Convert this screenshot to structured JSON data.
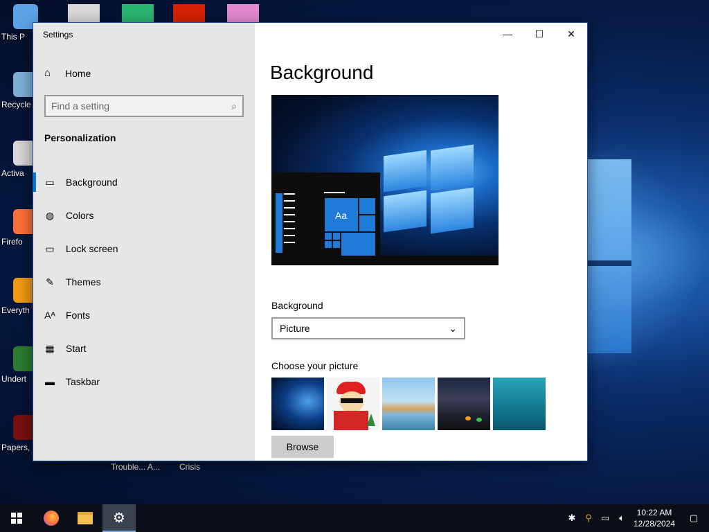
{
  "desktop": {
    "icons": [
      {
        "label": "This P",
        "color": "#5da4e6"
      },
      {
        "label": "Recycle",
        "color": "#7fb2d8"
      },
      {
        "label": "Activa",
        "color": "#d9d9d9"
      },
      {
        "label": "Firefo",
        "color": "#ff7139"
      },
      {
        "label": "Everyth",
        "color": "#f39c12"
      },
      {
        "label": "Undert",
        "color": "#2e7d32"
      },
      {
        "label": "Papers, P",
        "color": "#7a1010"
      }
    ],
    "top_icons": [
      {
        "color": "#d9d9d9"
      },
      {
        "color": "#2bb673"
      },
      {
        "color": "#d62300"
      },
      {
        "color": "#e38ad0"
      }
    ],
    "behind_labels": [
      "Trouble... A...",
      "Crisis"
    ]
  },
  "window": {
    "title": "Settings",
    "controls": {
      "minimize": "—",
      "maximize": "☐",
      "close": "✕"
    }
  },
  "sidebar": {
    "home": "Home",
    "search_placeholder": "Find a setting",
    "section": "Personalization",
    "items": [
      {
        "label": "Background",
        "icon": "image-icon",
        "glyph": "▭",
        "active": true
      },
      {
        "label": "Colors",
        "icon": "palette-icon",
        "glyph": "◍"
      },
      {
        "label": "Lock screen",
        "icon": "lock-screen-icon",
        "glyph": "▭"
      },
      {
        "label": "Themes",
        "icon": "themes-icon",
        "glyph": "✎"
      },
      {
        "label": "Fonts",
        "icon": "fonts-icon",
        "glyph": "Aᴬ"
      },
      {
        "label": "Start",
        "icon": "start-icon",
        "glyph": "▦"
      },
      {
        "label": "Taskbar",
        "icon": "taskbar-icon",
        "glyph": "▬"
      }
    ]
  },
  "main": {
    "title": "Background",
    "preview_sample_text": "Aa",
    "background_label": "Background",
    "background_value": "Picture",
    "choose_label": "Choose your picture",
    "browse_label": "Browse"
  },
  "taskbar": {
    "time": "10:22 AM",
    "date": "12/28/2024",
    "colors": {
      "accent": "#0078d7",
      "taskbar_bg": "#0a0f1a"
    }
  }
}
